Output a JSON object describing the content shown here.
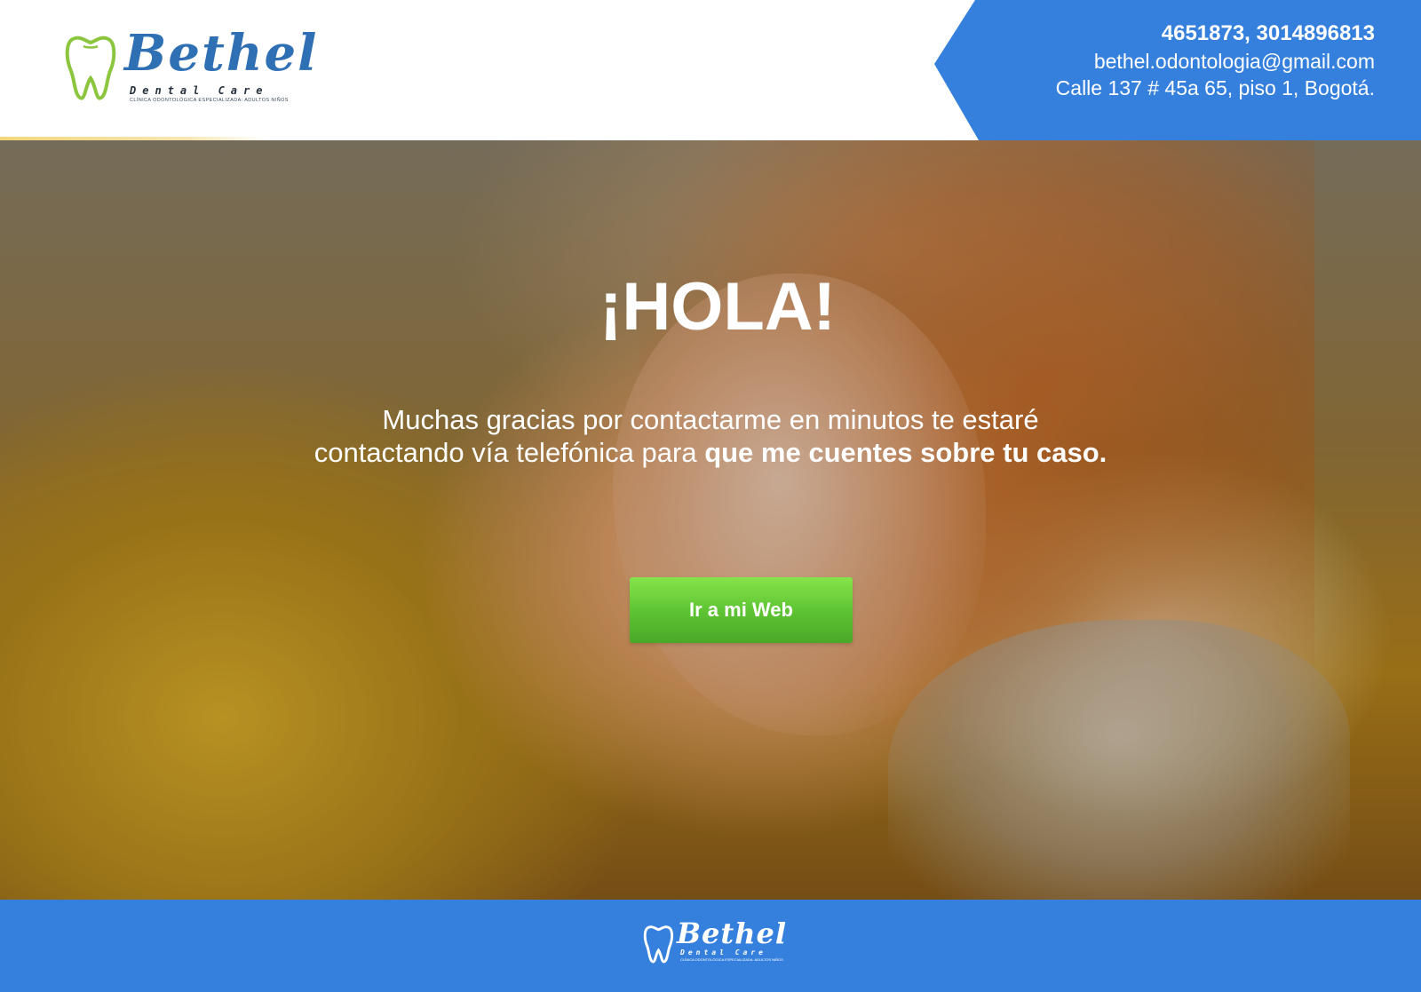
{
  "brand": {
    "name": "Bethel",
    "subtitle": "Dental Care",
    "tagline": "CLÍNICA ODONTOLÓGICA ESPECIALIZADA: ADULTOS NIÑOS",
    "logo_icon": "tooth-icon",
    "colors": {
      "primary_blue": "#3680dd",
      "logo_blue": "#2f6fb3",
      "tooth_green": "#8cc63f",
      "cta_green": "#5cc232"
    }
  },
  "contact": {
    "phone": "4651873, 3014896813",
    "email": "bethel.odontologia@gmail.com",
    "address": "Calle 137 # 45a 65, piso 1, Bogotá."
  },
  "hero": {
    "title": "¡HOLA!",
    "message_line1": "Muchas gracias por contactarme en minutos te estaré",
    "message_line2": "contactando vía telefónica para ",
    "message_bold": "que me cuentes sobre tu caso.",
    "cta_label": "Ir a mi Web"
  },
  "footer": {
    "brand_name": "Bethel",
    "brand_subtitle": "Dental Care",
    "brand_tagline": "CLÍNICA ODONTOLÓGICA ESPECIALIZADA: ADULTOS NIÑOS"
  }
}
